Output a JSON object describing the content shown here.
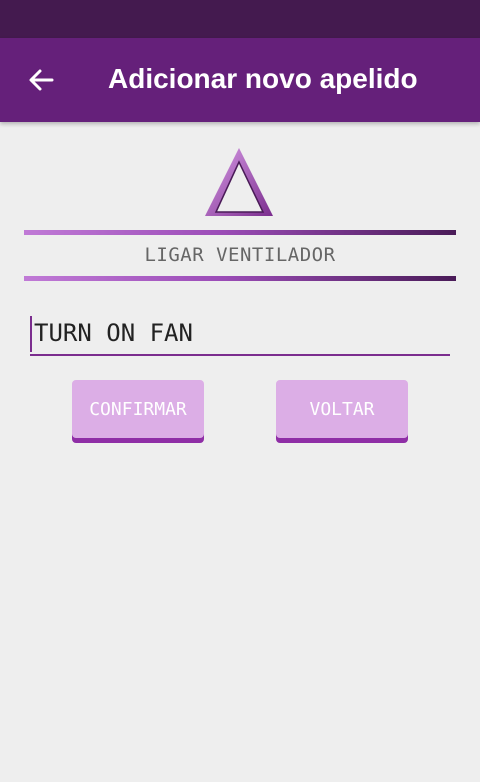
{
  "app_bar": {
    "title": "Adicionar novo apelido",
    "back_icon": "arrow-back-icon",
    "background": "#65207a"
  },
  "status_bar": {
    "background": "#441a4f"
  },
  "logo": {
    "icon": "triangle-logo-icon"
  },
  "command": {
    "label": "LIGAR VENTILADOR"
  },
  "nickname_input": {
    "value": "TURN ON FAN"
  },
  "buttons": {
    "confirm_label": "CONFIRMAR",
    "back_label": "VOLTAR"
  },
  "colors": {
    "accent": "#7b2d8e",
    "button_bg": "#dcaee6",
    "button_shadow": "#8f2ea6",
    "background": "#eeeeee"
  }
}
